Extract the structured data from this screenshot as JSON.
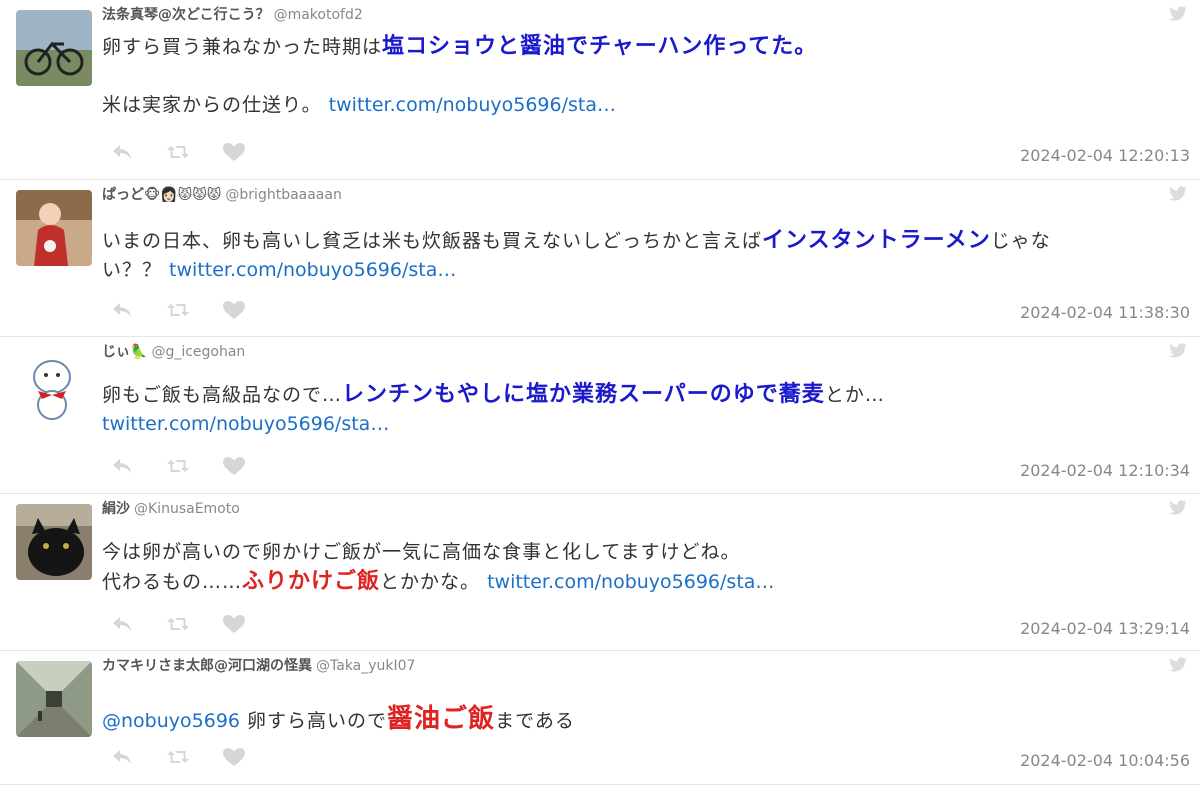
{
  "colors": {
    "highlight_blue": "#1a1acc",
    "highlight_red": "#e02222",
    "link": "#1b6fc7",
    "icon_gray": "#cccccc"
  },
  "tweets": [
    {
      "name": "法条真琴@次どこ行こう？",
      "handle": "@makotofd2",
      "lines": [
        {
          "parts": [
            {
              "t": "卵すら買う兼ねなかった時期は",
              "s": "normal"
            },
            {
              "t": "塩コショウと醤油でチャーハン作ってた。",
              "s": "blue"
            }
          ]
        },
        {
          "parts": [
            {
              "t": "",
              "s": "normal"
            }
          ]
        },
        {
          "parts": [
            {
              "t": "米は実家からの仕送り。 ",
              "s": "normal"
            },
            {
              "t": "twitter.com/nobuyo5696/sta…",
              "s": "link"
            }
          ]
        }
      ],
      "time": "2024-02-04 12:20:13",
      "avatar_icon": "bicycle-photo-avatar"
    },
    {
      "name": "ぱっど🐵👩🏻😾😾😾",
      "handle": "@brightbaaaaan",
      "lines": [
        {
          "parts": [
            {
              "t": "いまの日本、卵も高いし貧乏は米も炊飯器も買えないしどっちかと言えば",
              "s": "normal"
            },
            {
              "t": "インスタントラーメン",
              "s": "blue"
            },
            {
              "t": "じゃな",
              "s": "normal"
            }
          ]
        },
        {
          "parts": [
            {
              "t": "い？？ ",
              "s": "normal"
            },
            {
              "t": "twitter.com/nobuyo5696/sta…",
              "s": "link"
            }
          ]
        }
      ],
      "time": "2024-02-04 11:38:30",
      "avatar_icon": "girl-photo-avatar"
    },
    {
      "name": "じぃ🦜",
      "handle": "@g_icegohan",
      "lines": [
        {
          "parts": [
            {
              "t": "卵もご飯も高級品なので…",
              "s": "normal"
            },
            {
              "t": "レンチンもやしに塩か業務スーパーのゆで蕎麦",
              "s": "blue"
            },
            {
              "t": "とか…",
              "s": "normal"
            }
          ]
        },
        {
          "parts": [
            {
              "t": "twitter.com/nobuyo5696/sta…",
              "s": "link"
            }
          ]
        }
      ],
      "time": "2024-02-04 12:10:34",
      "avatar_icon": "dog-illustration-avatar"
    },
    {
      "name": "絹沙",
      "handle": "@KinusaEmoto",
      "lines": [
        {
          "parts": [
            {
              "t": "今は卵が高いので卵かけご飯が一気に高価な食事と化してますけどね。",
              "s": "normal"
            }
          ]
        },
        {
          "parts": [
            {
              "t": "代わるもの……",
              "s": "normal"
            },
            {
              "t": "ふりかけご飯",
              "s": "red"
            },
            {
              "t": "とかかな。 ",
              "s": "normal"
            },
            {
              "t": "twitter.com/nobuyo5696/sta…",
              "s": "link"
            }
          ]
        }
      ],
      "time": "2024-02-04 13:29:14",
      "avatar_icon": "black-cat-photo-avatar"
    },
    {
      "name": "カマキリさま太郎@河口湖の怪異",
      "handle": "@Taka_yukI07",
      "lines": [
        {
          "parts": []
        },
        {
          "parts": [
            {
              "t": "@nobuyo5696",
              "s": "link"
            },
            {
              "t": " 卵すら高いので",
              "s": "normal"
            },
            {
              "t": "醤油ご飯",
              "s": "redbig"
            },
            {
              "t": "まである",
              "s": "normal"
            }
          ]
        }
      ],
      "time": "2024-02-04 10:04:56",
      "avatar_icon": "corridor-photo-avatar"
    }
  ]
}
